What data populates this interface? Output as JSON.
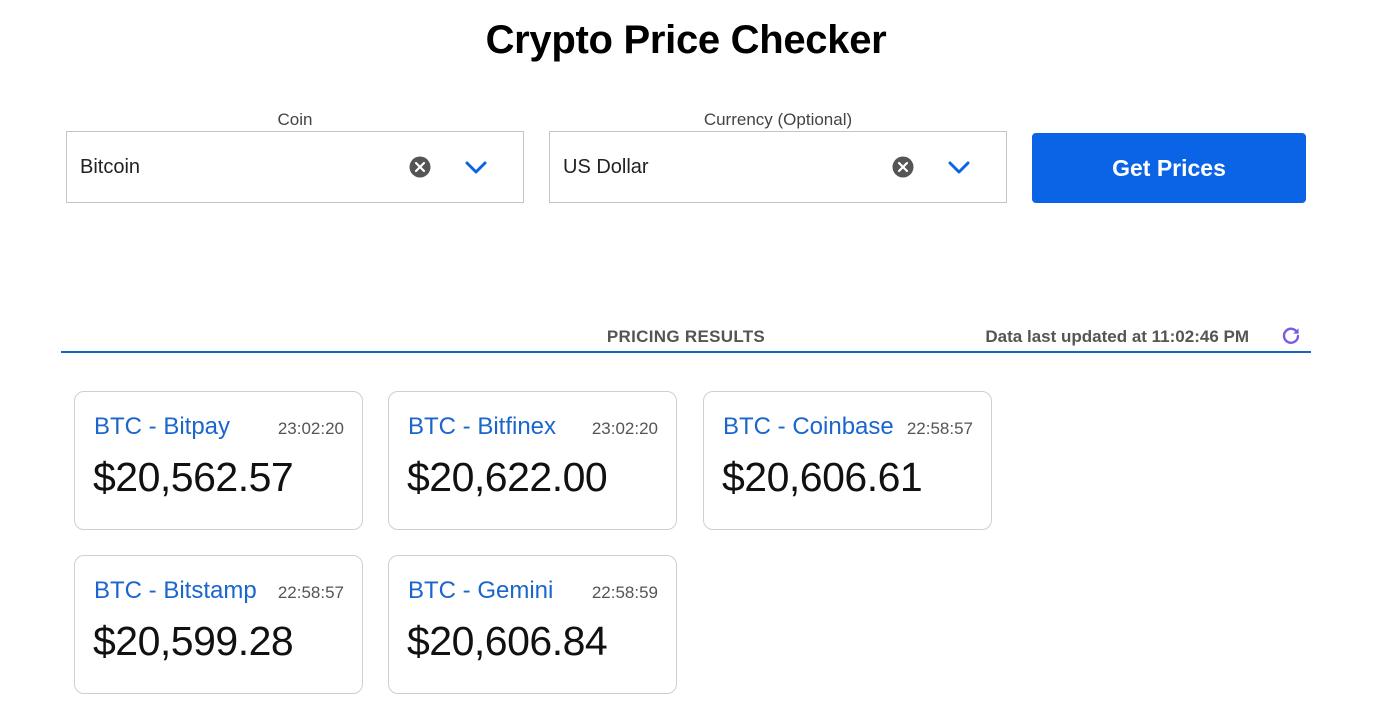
{
  "header": {
    "title": "Crypto Price Checker"
  },
  "form": {
    "coin": {
      "label": "Coin",
      "value": "Bitcoin"
    },
    "currency": {
      "label": "Currency (Optional)",
      "value": "US Dollar"
    },
    "submit_label": "Get Prices"
  },
  "results": {
    "title": "PRICING RESULTS",
    "updated": "Data last updated at 11:02:46 PM",
    "cards": [
      {
        "name": "BTC - Bitpay",
        "time": "23:02:20",
        "price": "$20,562.57"
      },
      {
        "name": "BTC - Bitfinex",
        "time": "23:02:20",
        "price": "$20,622.00"
      },
      {
        "name": "BTC - Coinbase",
        "time": "22:58:57",
        "price": "$20,606.61"
      },
      {
        "name": "BTC - Bitstamp",
        "time": "22:58:57",
        "price": "$20,599.28"
      },
      {
        "name": "BTC - Gemini",
        "time": "22:58:59",
        "price": "$20,606.84"
      }
    ]
  },
  "colors": {
    "accent": "#0b63e5",
    "link_blue": "#1a66cc",
    "divider": "#1565c0",
    "refresh": "#7b5ce0"
  },
  "icons": {
    "clear": "close-circle-icon",
    "dropdown": "chevron-down-icon",
    "refresh": "refresh-icon"
  }
}
